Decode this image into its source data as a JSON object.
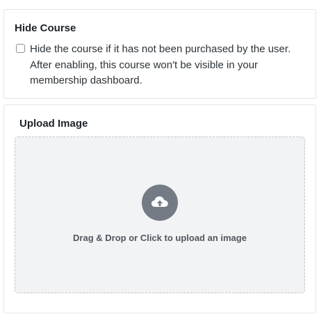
{
  "hide_course": {
    "title": "Hide Course",
    "checkbox_label": "Hide the course if it has not been purchased by the user. After enabling, this course won't be visible in your membership dashboard.",
    "checked": false
  },
  "upload_image": {
    "title": "Upload Image",
    "dropzone_text": "Drag & Drop or Click to upload an image",
    "icon": "cloud-upload-icon"
  },
  "colors": {
    "icon_circle": "#747b84",
    "dropzone_bg": "#f2f3f5",
    "dropzone_border": "#c3c4c7"
  }
}
